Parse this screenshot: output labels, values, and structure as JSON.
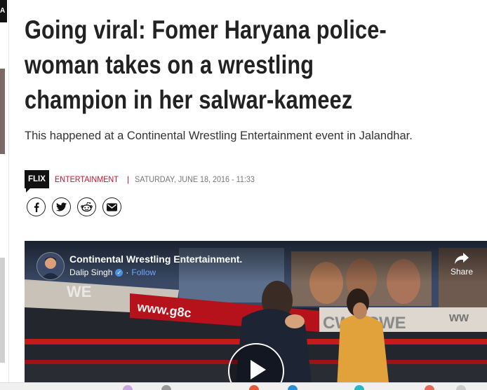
{
  "article": {
    "headline": "Going viral: Fomer Haryana police-woman takes on a wrestling champion in her salwar-kameez",
    "summary": "This happened at a Continental Wrestling Entertainment event in Jalandhar.",
    "source_badge": "FLIX",
    "category": "ENTERTAINMENT",
    "separator": "|",
    "datetime": "SATURDAY, JUNE 18, 2016 - 11:33"
  },
  "share_icons": [
    "facebook-icon",
    "twitter-icon",
    "reddit-icon",
    "email-icon"
  ],
  "video": {
    "page_name": "Continental Wrestling Entertainment.",
    "author": "Dalip Singh",
    "follow_label": "Follow",
    "follow_separator": "·",
    "share_label": "Share",
    "banner_text_1": "www.g8c",
    "banner_text_2": "CWE CWE",
    "banner_text_3": "WE",
    "banner_text_4": "ww"
  },
  "colors": {
    "accent": "#c8102e",
    "text": "#222222",
    "muted": "#777777",
    "follow": "#6ea8ff"
  }
}
